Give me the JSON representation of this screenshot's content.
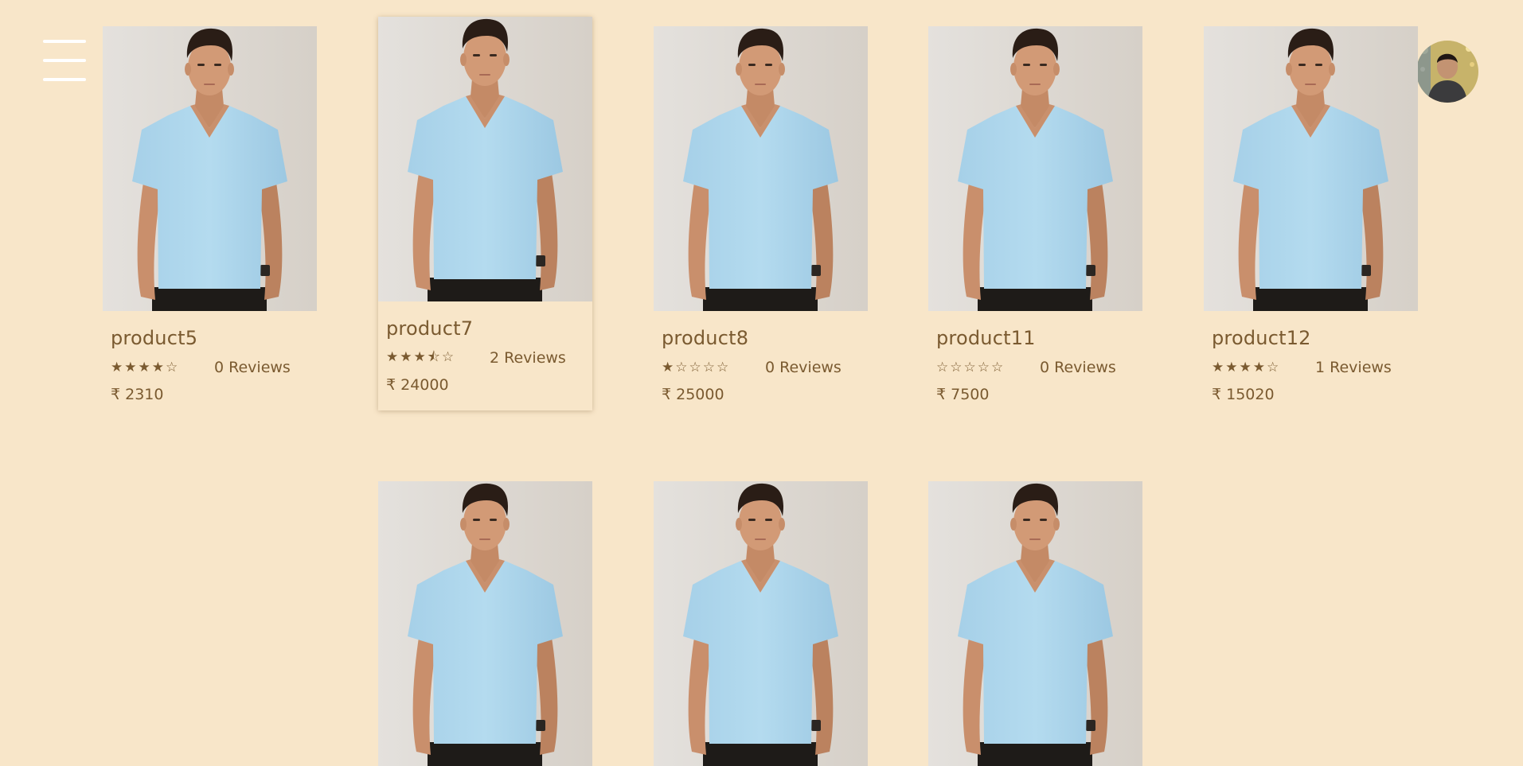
{
  "header": {
    "menu_icon": "hamburger-menu-icon",
    "avatar_icon": "user-avatar"
  },
  "colors": {
    "background": "#f8e6c9",
    "text": "#7a5a30",
    "menu_bars": "#ffffff",
    "shirt": "#a9d3ea"
  },
  "products": [
    {
      "name": "product5",
      "rating": 4,
      "stars": "★★★★☆",
      "reviews": "0 Reviews",
      "price": "₹ 2310"
    },
    {
      "name": "product7",
      "rating": 3.5,
      "stars": "★★★⯪☆",
      "reviews": "2 Reviews",
      "price": "₹ 24000"
    },
    {
      "name": "product8",
      "rating": 1,
      "stars": "★☆☆☆☆",
      "reviews": "0 Reviews",
      "price": "₹ 25000"
    },
    {
      "name": "product11",
      "rating": 0,
      "stars": "☆☆☆☆☆",
      "reviews": "0 Reviews",
      "price": "₹ 7500"
    },
    {
      "name": "product12",
      "rating": 4,
      "stars": "★★★★☆",
      "reviews": "1 Reviews",
      "price": "₹ 15020"
    }
  ]
}
